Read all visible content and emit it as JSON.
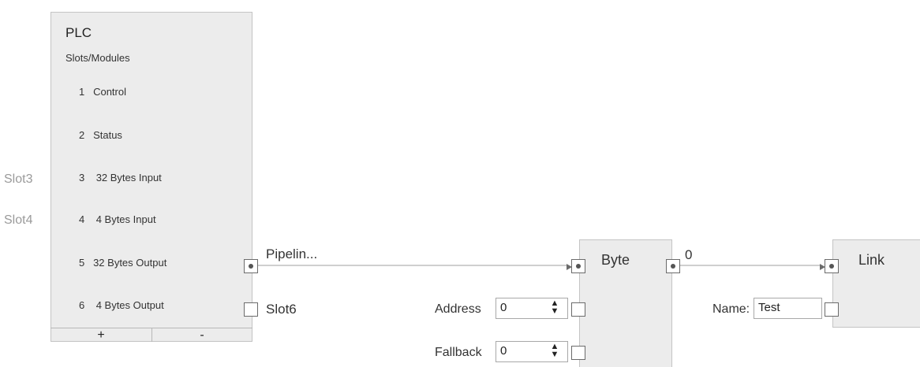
{
  "plc": {
    "title": "PLC",
    "subtitle": "Slots/Modules",
    "rows": [
      {
        "num": "1",
        "label": "Control"
      },
      {
        "num": "2",
        "label": "Status"
      },
      {
        "num": "3",
        "label": "32 Bytes Input"
      },
      {
        "num": "4",
        "label": "4 Bytes Input"
      },
      {
        "num": "5",
        "label": "32 Bytes Output"
      },
      {
        "num": "6",
        "label": "4 Bytes Output"
      }
    ],
    "add_label": "+",
    "remove_label": "-"
  },
  "side_labels": {
    "slot3": "Slot3",
    "slot4": "Slot4"
  },
  "outputs": {
    "pipeline": "Pipelin...",
    "slot6": "Slot6"
  },
  "byte_block": {
    "title": "Byte",
    "output_value": "0",
    "address_label": "Address",
    "address_value": "0",
    "fallback_label": "Fallback",
    "fallback_value": "0"
  },
  "link_block": {
    "title": "Link",
    "name_label": "Name:",
    "name_value": "Test"
  },
  "icons": {
    "spinner": "up-down-spinner-icon",
    "port": "connector-port-icon"
  }
}
